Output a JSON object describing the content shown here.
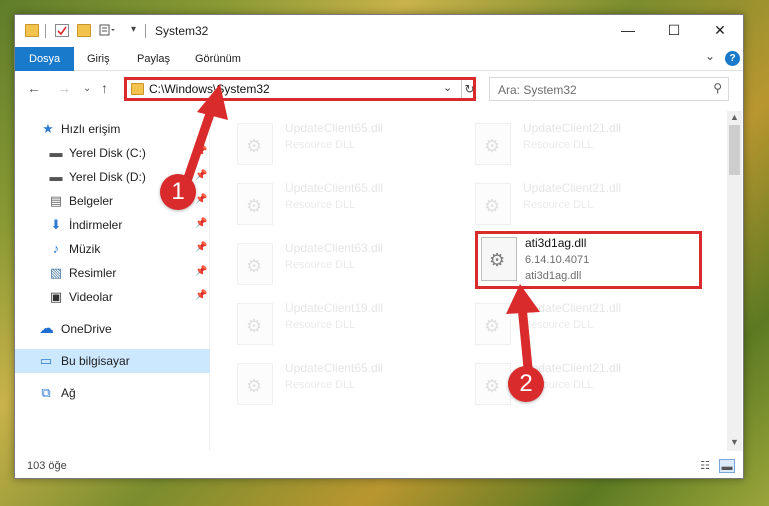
{
  "window": {
    "title": "System32",
    "minimize_glyph": "—",
    "maximize_glyph": "☐",
    "close_glyph": "✕"
  },
  "ribbon": {
    "tabs": [
      "Dosya",
      "Giriş",
      "Paylaş",
      "Görünüm"
    ],
    "expand_glyph": "⌄",
    "help_glyph": "?"
  },
  "address": {
    "path": "C:\\Windows\\System32",
    "search_placeholder": "Ara: System32"
  },
  "nav": {
    "items": [
      {
        "label": "Hızlı erişim",
        "icon": "star-icon",
        "glyph": "★",
        "pinned": false
      },
      {
        "label": "Yerel Disk (C:)",
        "icon": "drive-icon",
        "glyph": "▬",
        "pinned": true
      },
      {
        "label": "Yerel Disk (D:)",
        "icon": "drive-icon",
        "glyph": "▬",
        "pinned": true
      },
      {
        "label": "Belgeler",
        "icon": "documents-icon",
        "glyph": "▤",
        "pinned": true
      },
      {
        "label": "İndirmeler",
        "icon": "download-icon",
        "glyph": "⬇",
        "pinned": true
      },
      {
        "label": "Müzik",
        "icon": "music-icon",
        "glyph": "♪",
        "pinned": true
      },
      {
        "label": "Resimler",
        "icon": "pictures-icon",
        "glyph": "▧",
        "pinned": true
      },
      {
        "label": "Videolar",
        "icon": "video-icon",
        "glyph": "▣",
        "pinned": true
      },
      {
        "label": "OneDrive",
        "icon": "cloud-icon",
        "glyph": "☁",
        "pinned": false
      },
      {
        "label": "Bu bilgisayar",
        "icon": "computer-icon",
        "glyph": "▭",
        "pinned": false,
        "selected": true
      },
      {
        "label": "Ağ",
        "icon": "network-icon",
        "glyph": "⧉",
        "pinned": false
      }
    ]
  },
  "files": {
    "tiles": [
      {
        "name": "UpdateClient65.dll",
        "desc": "Resource DLL"
      },
      {
        "name": "UpdateClient21.dll",
        "desc": "Resource DLL"
      },
      {
        "name": "UpdateClient65.dll",
        "desc": "Resource DLL"
      },
      {
        "name": "UpdateClient21.dll",
        "desc": "Resource DLL"
      },
      {
        "name": "UpdateClient63.dll",
        "desc": "Resource DLL"
      },
      {
        "name": "UpdateClient19.dll",
        "desc": "Resource DLL"
      },
      {
        "name": "UpdateClient21.dll",
        "desc": "Resource DLL"
      },
      {
        "name": "UpdateClient65.dll",
        "desc": "Resource DLL"
      },
      {
        "name": "UpdateClient21.dll",
        "desc": "Resource DLL"
      }
    ],
    "highlighted": {
      "name": "ati3d1ag.dll",
      "version": "6.14.10.4071",
      "desc": "ati3d1ag.dll"
    }
  },
  "status": {
    "count": "103 öğe"
  },
  "annotations": {
    "badge1": "1",
    "badge2": "2",
    "color": "#d92b2b"
  }
}
